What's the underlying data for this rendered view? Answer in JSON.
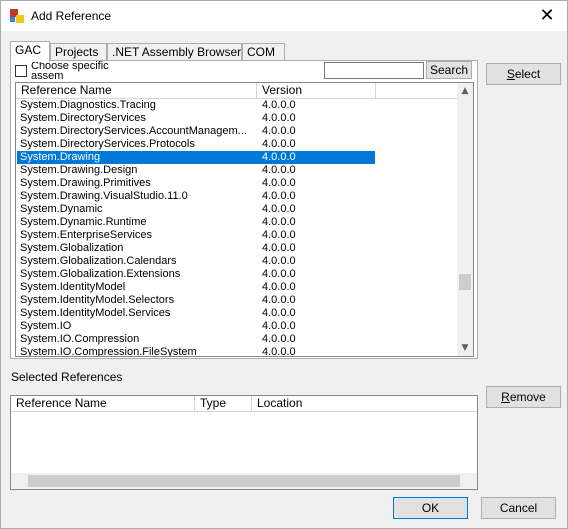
{
  "window": {
    "title": "Add Reference",
    "close_glyph": "✕"
  },
  "tabs": [
    {
      "label": "GAC",
      "active": true
    },
    {
      "label": "Projects",
      "active": false
    },
    {
      "label": ".NET Assembly Browser",
      "active": false
    },
    {
      "label": "COM",
      "active": false
    }
  ],
  "gac": {
    "choose_label": "Choose specific assem",
    "choose_checked": false,
    "search_value": "",
    "search_button": "Search",
    "columns": [
      "Reference Name",
      "Version"
    ],
    "rows": [
      {
        "name": "System.Diagnostics.Tracing",
        "version": "4.0.0.0"
      },
      {
        "name": "System.DirectoryServices",
        "version": "4.0.0.0"
      },
      {
        "name": "System.DirectoryServices.AccountManagem...",
        "version": "4.0.0.0"
      },
      {
        "name": "System.DirectoryServices.Protocols",
        "version": "4.0.0.0"
      },
      {
        "name": "System.Drawing",
        "version": "4.0.0.0",
        "selected": true
      },
      {
        "name": "System.Drawing.Design",
        "version": "4.0.0.0"
      },
      {
        "name": "System.Drawing.Primitives",
        "version": "4.0.0.0"
      },
      {
        "name": "System.Drawing.VisualStudio.11.0",
        "version": "4.0.0.0"
      },
      {
        "name": "System.Dynamic",
        "version": "4.0.0.0"
      },
      {
        "name": "System.Dynamic.Runtime",
        "version": "4.0.0.0"
      },
      {
        "name": "System.EnterpriseServices",
        "version": "4.0.0.0"
      },
      {
        "name": "System.Globalization",
        "version": "4.0.0.0"
      },
      {
        "name": "System.Globalization.Calendars",
        "version": "4.0.0.0"
      },
      {
        "name": "System.Globalization.Extensions",
        "version": "4.0.0.0"
      },
      {
        "name": "System.IdentityModel",
        "version": "4.0.0.0"
      },
      {
        "name": "System.IdentityModel.Selectors",
        "version": "4.0.0.0"
      },
      {
        "name": "System.IdentityModel.Services",
        "version": "4.0.0.0"
      },
      {
        "name": "System.IO",
        "version": "4.0.0.0"
      },
      {
        "name": "System.IO.Compression",
        "version": "4.0.0.0"
      },
      {
        "name": "System.IO.Compression.FileSystem",
        "version": "4.0.0.0"
      }
    ],
    "scroll_up_glyph": "▲",
    "scroll_down_glyph": "▼"
  },
  "actions": {
    "select_label_pre": "",
    "select_label_ul": "S",
    "select_label_post": "elect",
    "remove_label_pre": "",
    "remove_label_ul": "R",
    "remove_label_post": "emove",
    "ok_label": "OK",
    "cancel_label": "Cancel"
  },
  "selected_refs": {
    "label": "Selected References",
    "columns": [
      "Reference Name",
      "Type",
      "Location"
    ]
  },
  "colors": {
    "selection": "#0078d7",
    "window_bg": "#f0f0f0"
  }
}
